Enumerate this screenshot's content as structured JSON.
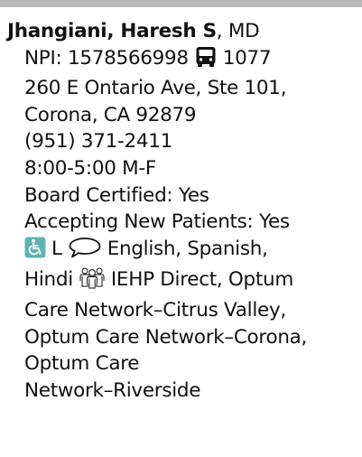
{
  "provider": {
    "name": "Jhangiani, Haresh S",
    "suffix": ", MD",
    "npi": "NPI: 1578566998",
    "transit_icon": "bus-icon",
    "transit_route": "1077",
    "address_line1": "260 E Ontario Ave, Ste 101,",
    "address_line2": "Corona, CA 92879",
    "phone": "(951) 371-2411",
    "hours": "8:00-5:00 M-F",
    "board_certified": "Board Certified: Yes",
    "accepting_new_patients": "Accepting New Patients: Yes",
    "accessibility_icon": "wheelchair-accessible-icon",
    "accessibility_level": "L",
    "language_icon": "speech-bubble-icon",
    "languages_line1": "English, Spanish,",
    "languages_line2": "Hindi",
    "network_icon": "provider-group-icon",
    "networks_line1": "IEHP Direct, Optum",
    "networks_line2": "Care Network–Citrus Valley,",
    "networks_line3": "Optum Care Network–Corona,",
    "networks_line4": "Optum Care",
    "networks_line5": "Network–Riverside"
  },
  "colors": {
    "text": "#111111",
    "accessibility_accent": "#5fb3b3",
    "top_bar": "#b8b8b8"
  }
}
